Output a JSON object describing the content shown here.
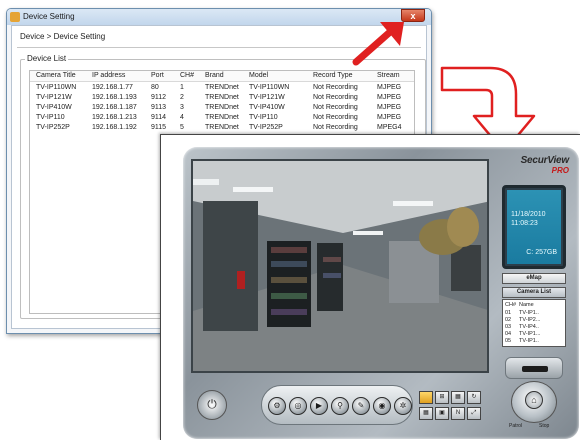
{
  "device_window": {
    "title": "Device Setting",
    "close_label": "x",
    "breadcrumb": "Device > Device Setting",
    "group_label": "Device List",
    "columns": [
      "Camera Title",
      "IP address",
      "Port",
      "CH#",
      "Brand",
      "Model",
      "Record Type",
      "Stream"
    ],
    "rows": [
      [
        "TV-IP110WN",
        "192.168.1.77",
        "80",
        "1",
        "TRENDnet",
        "TV-IP110WN",
        "Not Recording",
        "MJPEG"
      ],
      [
        "TV-IP121W",
        "192.168.1.193",
        "9112",
        "2",
        "TRENDnet",
        "TV-IP121W",
        "Not Recording",
        "MJPEG"
      ],
      [
        "TV-IP410W",
        "192.168.1.187",
        "9113",
        "3",
        "TRENDnet",
        "TV-IP410W",
        "Not Recording",
        "MJPEG"
      ],
      [
        "TV-IP110",
        "192.168.1.213",
        "9114",
        "4",
        "TRENDnet",
        "TV-IP110",
        "Not Recording",
        "MJPEG"
      ],
      [
        "TV-IP252P",
        "192.168.1.192",
        "9115",
        "5",
        "TRENDnet",
        "TV-IP252P",
        "Not Recording",
        "MPEG4"
      ]
    ]
  },
  "securview": {
    "logo": "SecurView",
    "logo_sub": "PRO",
    "lcd_date": "11/18/2010",
    "lcd_time": "11:08:23",
    "lcd_disk": "C: 257GB",
    "emap_label": "eMap",
    "camera_list_label": "Camera List",
    "camera_list_headers": [
      "CH#",
      "Name"
    ],
    "camera_list": [
      [
        "01",
        "TV-IP1.."
      ],
      [
        "02",
        "TV-IP2..."
      ],
      [
        "03",
        "TV-IP4.."
      ],
      [
        "04",
        "TV-IP1..."
      ],
      [
        "05",
        "TV-IP1.."
      ]
    ],
    "patrol_label": "Patrol",
    "stop_label": "Stop"
  },
  "colors": {
    "close_red": "#c4371a",
    "lcd_blue": "#1a7ba0",
    "logo_red": "#c51818",
    "arrow_red": "#e02020"
  }
}
